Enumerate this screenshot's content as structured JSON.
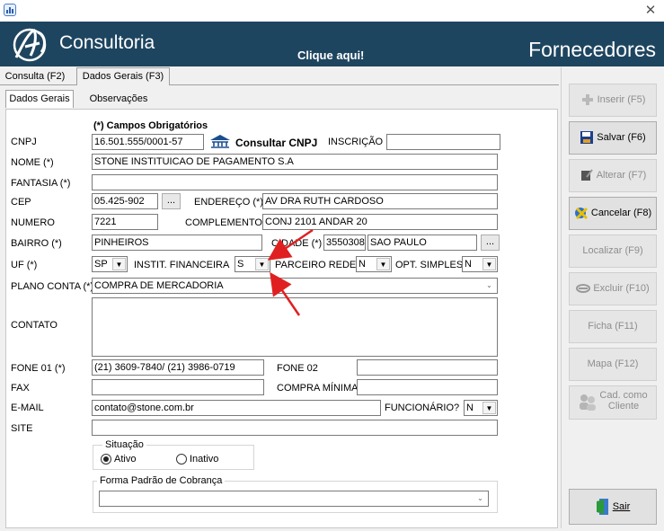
{
  "window": {
    "close_glyph": "✕"
  },
  "banner": {
    "brand": "Consultoria",
    "link": "Clique aqui!",
    "title": "Fornecedores"
  },
  "tabs_main": [
    {
      "label": "Consulta (F2)"
    },
    {
      "label": "Dados Gerais (F3)"
    }
  ],
  "tabs_sub": [
    {
      "label": "Dados Gerais"
    },
    {
      "label": "Observações"
    }
  ],
  "form": {
    "required_note": "(*) Campos Obrigatórios",
    "cnpj_label": "CNPJ",
    "cnpj": "16.501.555/0001-57",
    "consultar": "Consultar CNPJ",
    "inscricao_label": "INSCRIÇÃO",
    "inscricao": "",
    "nome_label": "NOME (*)",
    "nome": "STONE INSTITUICAO DE PAGAMENTO S.A",
    "fantasia_label": "FANTASIA (*)",
    "fantasia": "",
    "cep_label": "CEP",
    "cep": "05.425-902",
    "ellipsis": "...",
    "endereco_label": "ENDEREÇO (*)",
    "endereco": "AV DRA RUTH CARDOSO",
    "numero_label": "NUMERO",
    "numero": "7221",
    "complemento_label": "COMPLEMENTO",
    "complemento": "CONJ 2101 ANDAR 20",
    "bairro_label": "BAIRRO (*)",
    "bairro": "PINHEIROS",
    "cidade_label": "CIDADE (*)",
    "cidade_code": "3550308",
    "cidade": "SAO PAULO",
    "uf_label": "UF (*)",
    "uf": "SP",
    "instit_label": "INSTIT. FINANCEIRA",
    "instit": "S",
    "parceiro_label": "PARCEIRO REDE",
    "parceiro": "N",
    "opt_label": "OPT. SIMPLES",
    "opt": "N",
    "plano_label": "PLANO CONTA (*)",
    "plano": "COMPRA DE MERCADORIA",
    "contato_label": "CONTATO",
    "contato": "",
    "fone1_label": "FONE 01 (*)",
    "fone1": "(21) 3609-7840/ (21) 3986-0719",
    "fone2_label": "FONE 02",
    "fone2": "",
    "fax_label": "FAX",
    "fax": "",
    "compra_label": "COMPRA MÍNIMA",
    "compra": "",
    "email_label": "E-MAIL",
    "email": "contato@stone.com.br",
    "funcionario_label": "FUNCIONÁRIO?",
    "funcionario": "N",
    "site_label": "SITE",
    "site": "",
    "situacao_title": "Situação",
    "ativo": "Ativo",
    "inativo": "Inativo",
    "cobranca_title": "Forma Padrão de Cobrança",
    "cobranca": ""
  },
  "buttons": {
    "inserir": "Inserir (F5)",
    "salvar": "Salvar (F6)",
    "alterar": "Alterar (F7)",
    "cancelar": "Cancelar (F8)",
    "localizar": "Localizar (F9)",
    "excluir": "Excluir (F10)",
    "ficha": "Ficha (F11)",
    "mapa": "Mapa (F12)",
    "cad_line1": "Cad. como",
    "cad_line2": "Cliente",
    "sair": "Sair"
  },
  "colors": {
    "banner": "#1e4560",
    "annotation_arrow": "#e02020"
  }
}
